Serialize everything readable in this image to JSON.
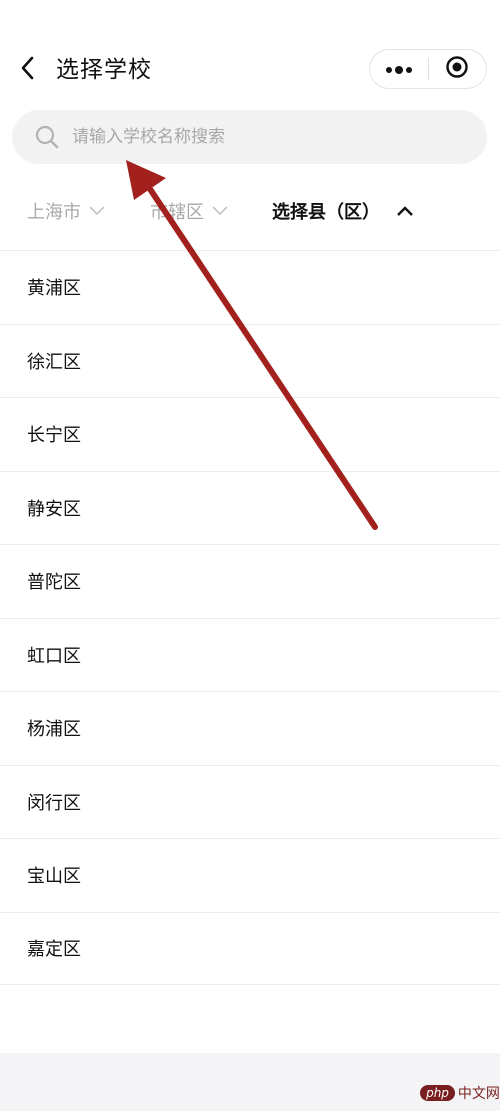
{
  "header": {
    "title": "选择学校",
    "back_icon": "chevron-left-icon",
    "more_icon": "more-dots-icon",
    "close_icon": "target-circle-icon"
  },
  "search": {
    "placeholder": "请输入学校名称搜索",
    "value": "",
    "icon": "search-icon"
  },
  "filters": [
    {
      "label": "上海市",
      "state": "inactive"
    },
    {
      "label": "市辖区",
      "state": "inactive"
    },
    {
      "label": "选择县（区）",
      "state": "active"
    }
  ],
  "districts": [
    "黄浦区",
    "徐汇区",
    "长宁区",
    "静安区",
    "普陀区",
    "虹口区",
    "杨浦区",
    "闵行区",
    "宝山区",
    "嘉定区"
  ],
  "watermark": {
    "logo": "php",
    "text": "中文网"
  },
  "colors": {
    "annotation_arrow": "#a3211c",
    "search_bg": "#f2f2f2",
    "inactive_text": "#a9a9a9",
    "divider": "#ededed",
    "footer_bg": "#f4f4f6"
  }
}
